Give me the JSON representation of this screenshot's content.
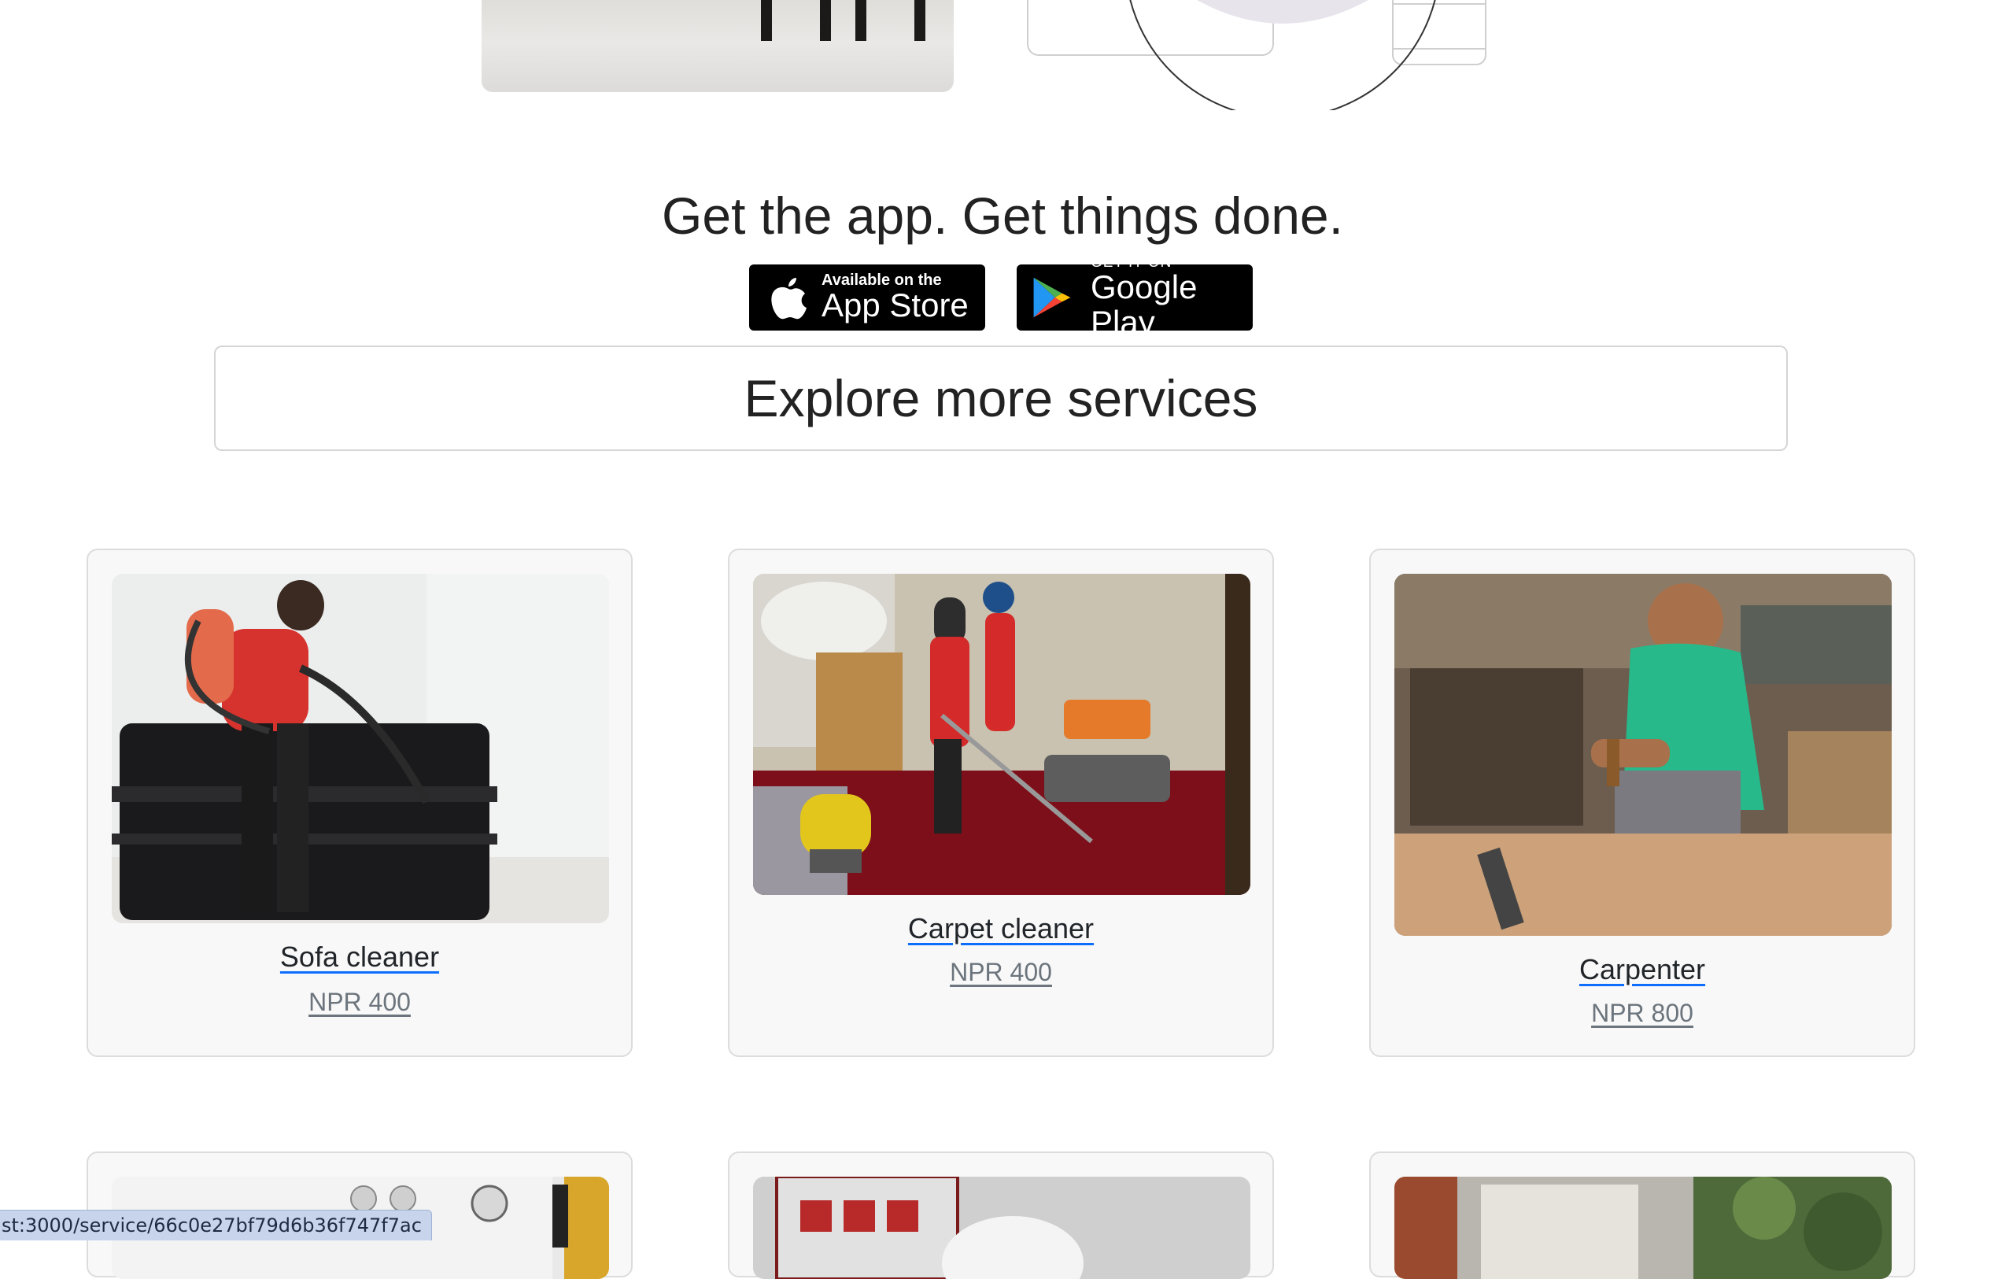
{
  "app_section": {
    "headline": "Get the app. Get things done.",
    "app_store": {
      "small": "Available on the",
      "big": "App Store"
    },
    "google_play": {
      "small": "GET IT ON",
      "big": "Google Play"
    }
  },
  "explore": {
    "label": "Explore more services"
  },
  "services": [
    {
      "title": "Sofa cleaner",
      "price": "NPR 400"
    },
    {
      "title": "Carpet cleaner",
      "price": "NPR 400"
    },
    {
      "title": "Carpenter",
      "price": "NPR 800"
    }
  ],
  "status_bar": {
    "url": "st:3000/service/66c0e27bf79d6b36f747f7ac"
  },
  "colors": {
    "link": "#0d6efd",
    "muted": "#6c757d",
    "card_bg": "#f8f8f8"
  },
  "icons": [
    "apple-icon",
    "google-play-icon"
  ]
}
